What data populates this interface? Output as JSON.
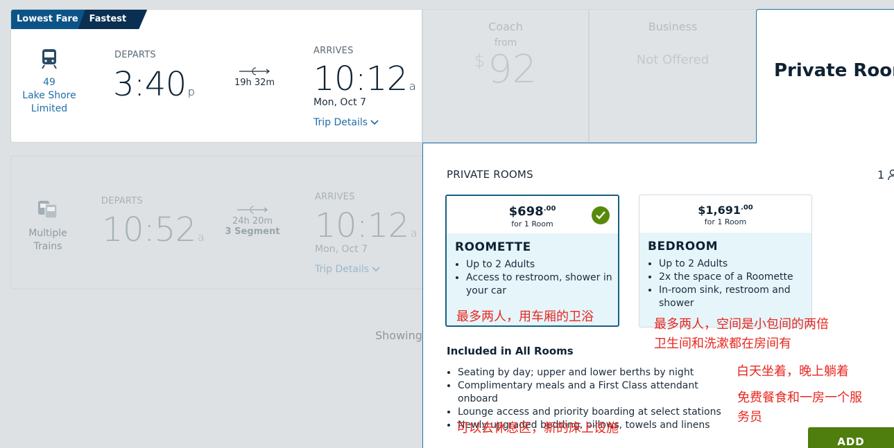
{
  "train1": {
    "badges": {
      "lowest": "Lowest Fare",
      "fastest": "Fastest"
    },
    "icon": "train-icon",
    "number": "49",
    "name_line1": "Lake Shore",
    "name_line2": "Limited",
    "departs_label": "DEPARTS",
    "departs_time": "3:40",
    "departs_ampm": "p",
    "duration": "19h 32m",
    "arrives_label": "ARRIVES",
    "arrives_time": "10:12",
    "arrives_ampm": "a",
    "arrives_date": "Mon, Oct 7",
    "trip_details": "Trip Details"
  },
  "train2": {
    "icon": "multiple-trains-icon",
    "name_line1": "Multiple",
    "name_line2": "Trains",
    "departs_label": "DEPARTS",
    "departs_time": "10:52",
    "departs_ampm": "a",
    "duration": "24h 20m",
    "segments": "3 Segment",
    "arrives_label": "ARRIVES",
    "arrives_time": "10:12",
    "arrives_ampm": "a",
    "arrives_date": "Mon, Oct 7",
    "trip_details": "Trip Details"
  },
  "showing": "Showing",
  "fares": {
    "coach": {
      "name": "Coach",
      "from": "from",
      "currency": "$",
      "price": "92"
    },
    "business": {
      "name": "Business",
      "status": "Not Offered"
    },
    "private": {
      "name": "Private Room"
    }
  },
  "panel": {
    "title": "PRIVATE ROOMS",
    "count": "1",
    "rooms": [
      {
        "price_main": "$698",
        "price_cents": ".00",
        "for": "for 1 Room",
        "name": "ROOMETTE",
        "selected": true,
        "features": [
          "Up to 2 Adults",
          "Access to restroom, shower in your car"
        ]
      },
      {
        "price_main": "$1,691",
        "price_cents": ".00",
        "for": "for 1 Room",
        "name": "BEDROOM",
        "selected": false,
        "features": [
          "Up to 2 Adults",
          "2x the space of a Roomette",
          "In-room sink, restroom and shower"
        ]
      }
    ],
    "included_title": "Included in All Rooms",
    "included": [
      "Seating by day; upper and lower berths by night",
      "Complimentary meals and a First Class attendant onboard",
      "Lounge access and priority boarding at select stations",
      "Newly upgraded bedding, pillows, towels and linens"
    ],
    "add_button": "ADD"
  },
  "annotations": {
    "roomette": "最多两人，用车厢的卫浴",
    "bedroom_line1": "最多两人，空间是小包间的两倍",
    "bedroom_line2": "卫生间和洗漱都在房间有",
    "seating": "白天坐着，晚上躺着",
    "meals_line1": "免费餐食和一房一个服",
    "meals_line2": "务员",
    "lounge": "可以去休息区，新的床上设施"
  },
  "colors": {
    "brand_blue": "#0c5488",
    "navy": "#0a2f52",
    "link_blue": "#1e6fa8",
    "selected_green": "#578a0a",
    "add_green": "#4f7d0e",
    "annotation_red": "#e8261f"
  }
}
